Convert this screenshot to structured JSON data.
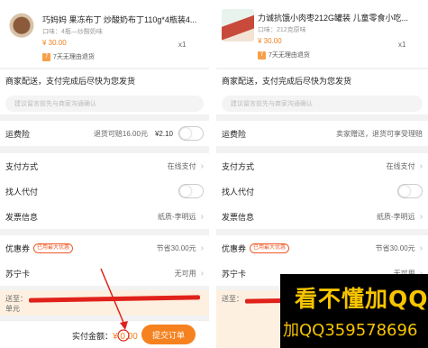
{
  "left": {
    "product": {
      "title": "巧妈妈 果冻布丁 炒酸奶布丁110g*4瓶装4...",
      "spec": "口味：4瓶—炒酸奶味",
      "price": "¥ 30.00",
      "qty": "x1",
      "return_tag": "7天无理由退货"
    },
    "shipping_text": "商家配送，支付完成后尽快为您发货",
    "memo_placeholder": "建议留言前先与商家沟通确认",
    "freight": {
      "label": "运费险",
      "value": "退货可赔16.00元",
      "price": "¥2.10"
    },
    "payment": {
      "label": "支付方式",
      "value": "在线支付"
    },
    "proxy": {
      "label": "找人代付"
    },
    "invoice": {
      "label": "发票信息",
      "value": "纸质-李明远"
    },
    "coupon": {
      "label": "优惠券",
      "badge": "已用最大优惠",
      "value": "节省30.00元"
    },
    "card": {
      "label": "苏宁卡",
      "value": "无可用"
    },
    "address": {
      "line1": "送至：",
      "line2": "单元"
    },
    "total_label": "实付金额：",
    "total_amount": "¥ 0.00",
    "submit": "提交订单"
  },
  "right": {
    "product": {
      "title": "力诚抗饿小肉枣212G罐装 儿童零食小吃...",
      "spec": "口味：212克原味",
      "price": "¥ 30.00",
      "qty": "x1",
      "return_tag": "7天无理由退货"
    },
    "shipping_text": "商家配送，支付完成后尽快为您发货",
    "memo_placeholder": "建议留言前先与商家沟通确认",
    "freight": {
      "label": "运费险",
      "value": "卖家赠送，退货可享受理赔"
    },
    "payment": {
      "label": "支付方式",
      "value": "在线支付"
    },
    "proxy": {
      "label": "找人代付"
    },
    "invoice": {
      "label": "发票信息",
      "value": "纸质-李明远"
    },
    "coupon": {
      "label": "优惠券",
      "badge": "已用最大优惠",
      "value": "节省30.00元"
    },
    "card": {
      "label": "苏宁卡",
      "value": "无可用"
    },
    "address": {
      "line1": "送至："
    }
  },
  "watermark": {
    "line1": "看不懂加QQ",
    "line2": "加QQ359578696"
  },
  "colors": {
    "accent": "#f5821f",
    "price": "#f0801e",
    "redaction": "#e0221b",
    "watermark_text": "#f7c400"
  }
}
